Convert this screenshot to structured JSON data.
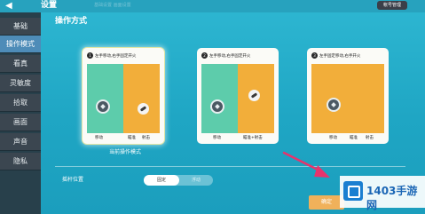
{
  "header": {
    "back_icon": "back-arrow-icon",
    "title": "设置",
    "faint_tab": "基础设置 画面设置",
    "right_button": "帐号管理"
  },
  "sidebar": {
    "items": [
      {
        "label": "基础",
        "active": false
      },
      {
        "label": "操作模式",
        "active": true
      },
      {
        "label": "看真",
        "active": false
      },
      {
        "label": "灵敏度",
        "active": false
      },
      {
        "label": "拾取",
        "active": false
      },
      {
        "label": "画面",
        "active": false
      },
      {
        "label": "声音",
        "active": false
      },
      {
        "label": "隐私",
        "active": false
      }
    ]
  },
  "main": {
    "section_title": "操作方式",
    "cards": [
      {
        "num": "1",
        "title": "左手移动,右手固定开火",
        "labels": [
          "移动",
          "瞄准",
          "射击"
        ],
        "selected": true
      },
      {
        "num": "2",
        "title": "左手移动,右手固定开火",
        "labels": [
          "移动",
          "瞄准+射击"
        ],
        "selected": false
      },
      {
        "num": "3",
        "title": "左手固定移动,右手开火",
        "labels": [
          "移动",
          "瞄准",
          "射击"
        ],
        "selected": false
      }
    ],
    "current_mode_label": "当前操作模式",
    "joystick_position_label": "摇杆位置",
    "toggle": {
      "on": "固定",
      "off": "浮动"
    },
    "confirm_label": "确定"
  },
  "watermark": {
    "text": "1403手游网"
  },
  "colors": {
    "accent": "#4e8cb8",
    "green_zone": "#5dccab",
    "orange_zone": "#f2ae3a",
    "arrow": "#e8336c"
  }
}
